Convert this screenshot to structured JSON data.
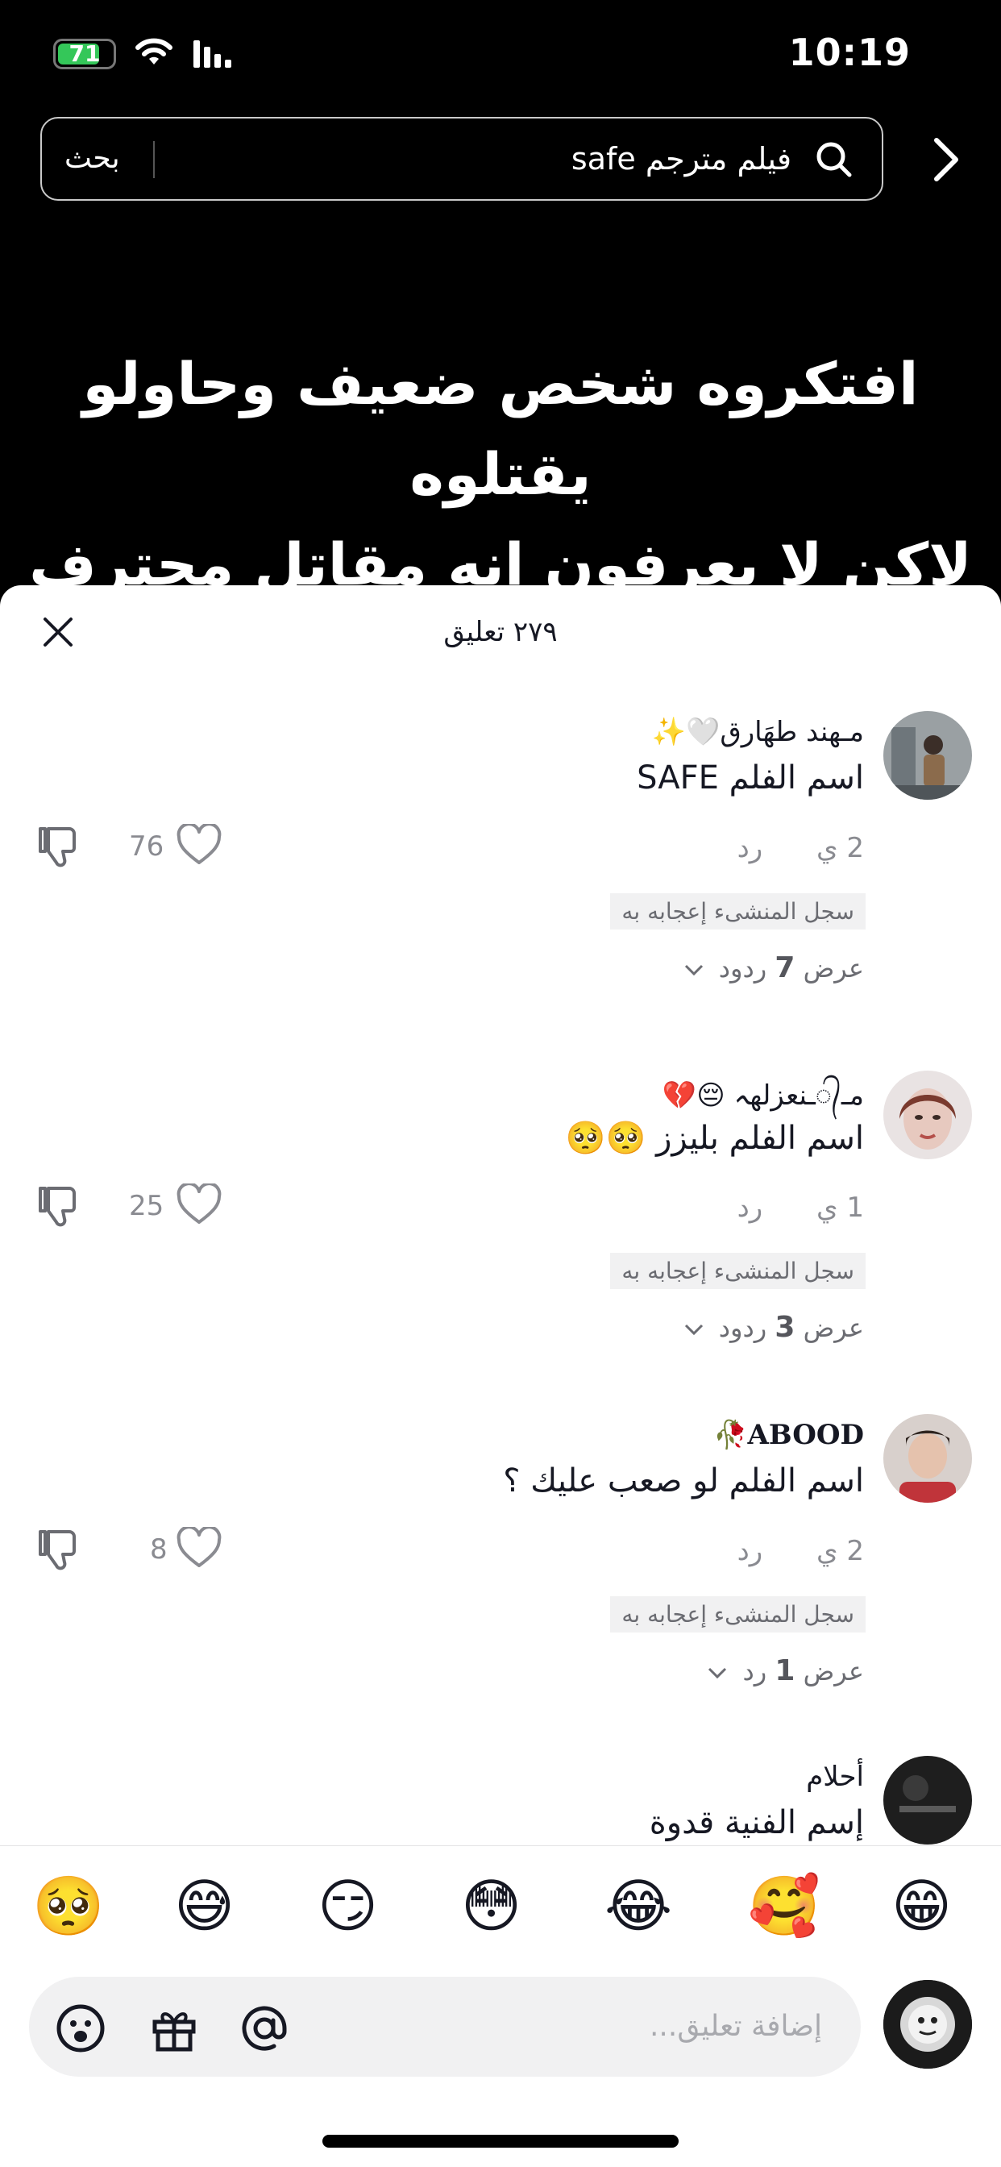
{
  "status_bar": {
    "time": "10:19",
    "battery": "71",
    "battery_level": 0.71
  },
  "search": {
    "query": "فيلم مترجم safe",
    "button_label": "بحث"
  },
  "video": {
    "overlay_line1": "افتكروه شخص ضعيف وحاولو يقتلوه",
    "overlay_line2": "لاكن لا يعرفون انه مقاتل محترف"
  },
  "comments_header": {
    "title": "٢٧٩ تعليق"
  },
  "comments": [
    {
      "username": "مـهند طهَارق🤍✨",
      "text": "اسم الفلم SAFE",
      "date": "2 ي",
      "reply": "رد",
      "likes": "76",
      "creator_liked": "سجل المنشىء إعجابه به",
      "view_prefix": "عرض",
      "view_count": "7",
      "view_suffix": "ردود"
    },
    {
      "username": "مـ᭄ـنعزلهہ 😔💔",
      "text": "اسم الفلم بليزز 🥺🥺",
      "date": "1 ي",
      "reply": "رد",
      "likes": "25",
      "creator_liked": "سجل المنشىء إعجابه به",
      "view_prefix": "عرض",
      "view_count": "3",
      "view_suffix": "ردود"
    },
    {
      "username": "ABOOD🥀",
      "text": "اسم الفلم لو صعب عليك ؟",
      "date": "2 ي",
      "reply": "رد",
      "likes": "8",
      "creator_liked": "سجل المنشىء إعجابه به",
      "view_prefix": "عرض",
      "view_count": "1",
      "view_suffix": "رد"
    },
    {
      "username": "أحلام",
      "text": "إسم الفنية قدوة"
    }
  ],
  "quick_emojis": [
    "😁",
    "🥰",
    "😂",
    "😳",
    "😏",
    "😅",
    "🥺"
  ],
  "comment_input": {
    "placeholder": "إضافة تعليق..."
  }
}
